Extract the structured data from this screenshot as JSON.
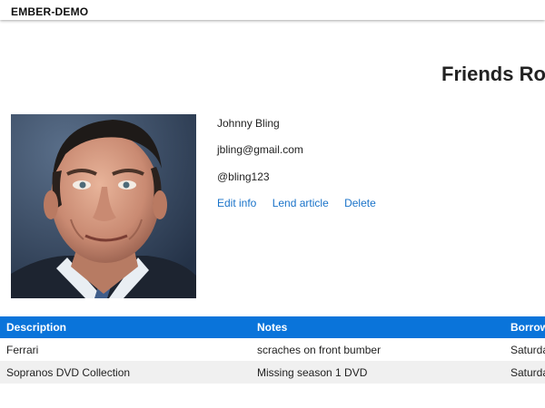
{
  "navbar": {
    "brand": "EMBER-DEMO"
  },
  "page": {
    "title": "Friends Ro"
  },
  "friend": {
    "name": "Johnny Bling",
    "email": "jbling@gmail.com",
    "twitter": "@bling123",
    "avatar_icon": "person-photo-icon"
  },
  "actions": {
    "edit": "Edit info",
    "lend": "Lend article",
    "delete": "Delete"
  },
  "table": {
    "headers": [
      "Description",
      "Notes",
      "Borrow"
    ],
    "rows": [
      [
        "Ferrari",
        "scraches on front bumber",
        "Saturda"
      ],
      [
        "Sopranos DVD Collection",
        "Missing season 1 DVD",
        "Saturda"
      ]
    ]
  },
  "colors": {
    "accent": "#0a74da",
    "link": "#1a73c9",
    "row_alt": "#f0f0f0"
  }
}
